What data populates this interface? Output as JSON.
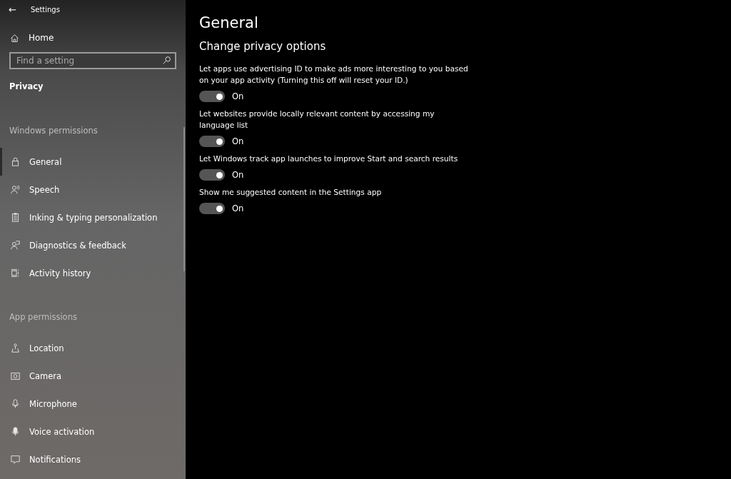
{
  "window": {
    "title": "Settings",
    "back": "←"
  },
  "sidebar": {
    "home": "Home",
    "search": {
      "placeholder": "Find a setting"
    },
    "section": "Privacy",
    "groups": [
      {
        "heading": "Windows permissions",
        "items": [
          {
            "label": "General",
            "selected": true
          },
          {
            "label": "Speech",
            "selected": false
          },
          {
            "label": "Inking & typing personalization",
            "selected": false
          },
          {
            "label": "Diagnostics & feedback",
            "selected": false
          },
          {
            "label": "Activity history",
            "selected": false
          }
        ]
      },
      {
        "heading": "App permissions",
        "items": [
          {
            "label": "Location",
            "selected": false
          },
          {
            "label": "Camera",
            "selected": false
          },
          {
            "label": "Microphone",
            "selected": false
          },
          {
            "label": "Voice activation",
            "selected": false
          },
          {
            "label": "Notifications",
            "selected": false
          }
        ]
      }
    ]
  },
  "page": {
    "title": "General",
    "subtitle": "Change privacy options",
    "options": [
      {
        "text": "Let apps use advertising ID to make ads more interesting to you based on your app activity (Turning this off will reset your ID.)",
        "on": true,
        "state": "On"
      },
      {
        "text": "Let websites provide locally relevant content by accessing my language list",
        "on": true,
        "state": "On"
      },
      {
        "text": "Let Windows track app launches to improve Start and search results",
        "on": true,
        "state": "On"
      },
      {
        "text": "Show me suggested content in the Settings app",
        "on": true,
        "state": "On"
      }
    ]
  }
}
